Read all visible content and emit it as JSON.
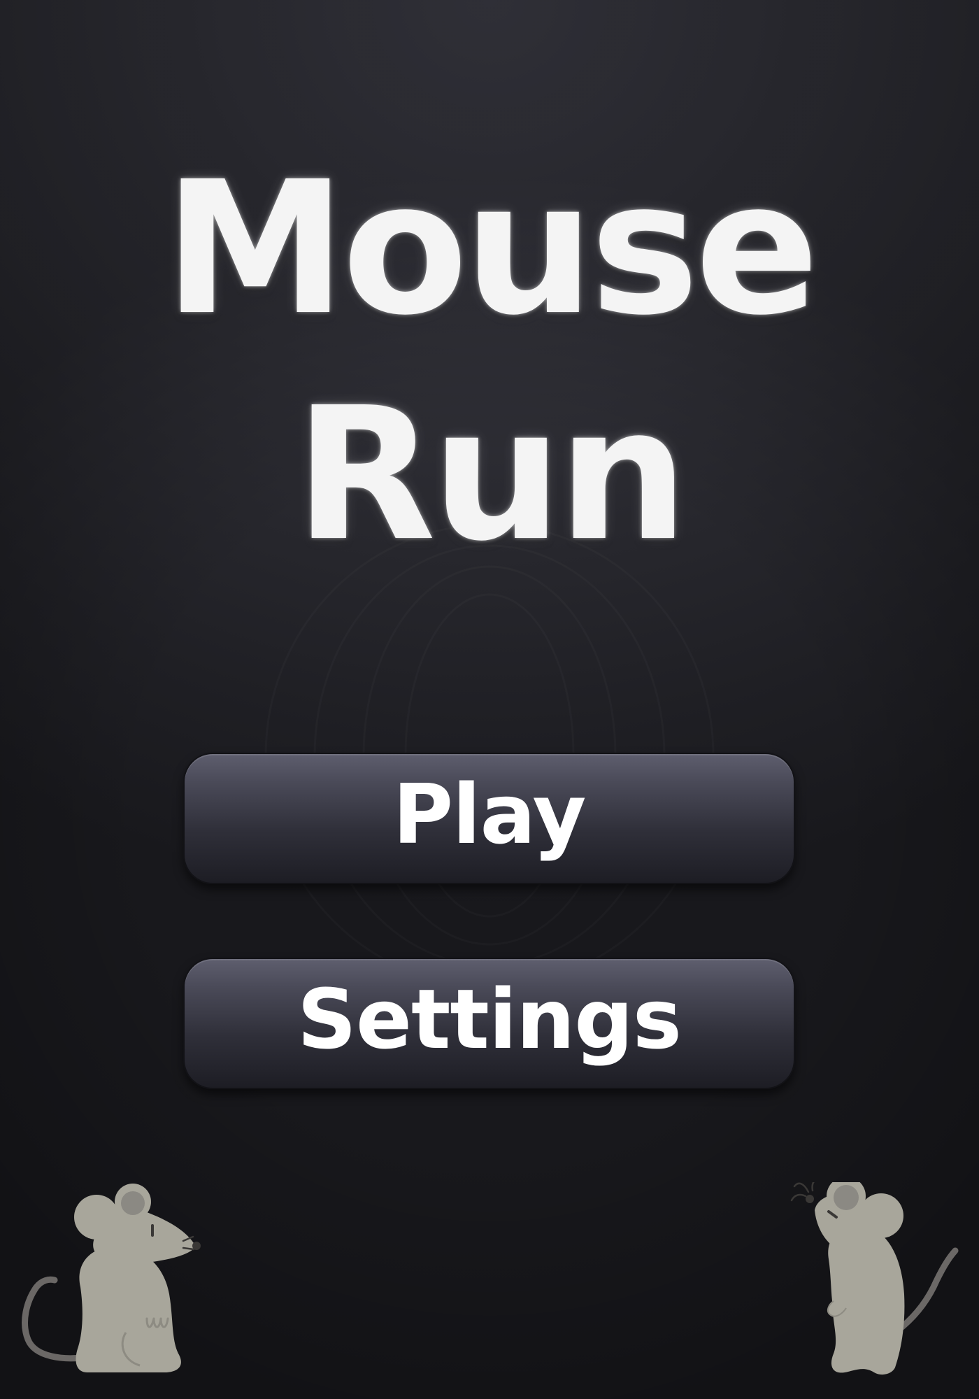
{
  "title": {
    "line1": "Mouse",
    "line2": "Run"
  },
  "menu": {
    "play_label": "Play",
    "settings_label": "Settings"
  },
  "decorations": {
    "left_icon": "sitting-mouse",
    "right_icon": "standing-mouse"
  },
  "colors": {
    "background_top": "#3f3f49",
    "background_bottom": "#18181c",
    "button_top": "#5e5e6e",
    "button_bottom": "#1d1d24",
    "mouse_body": "#a8a69b",
    "mouse_ear_inner": "#8b8983",
    "mouse_tail": "#6b6866"
  }
}
